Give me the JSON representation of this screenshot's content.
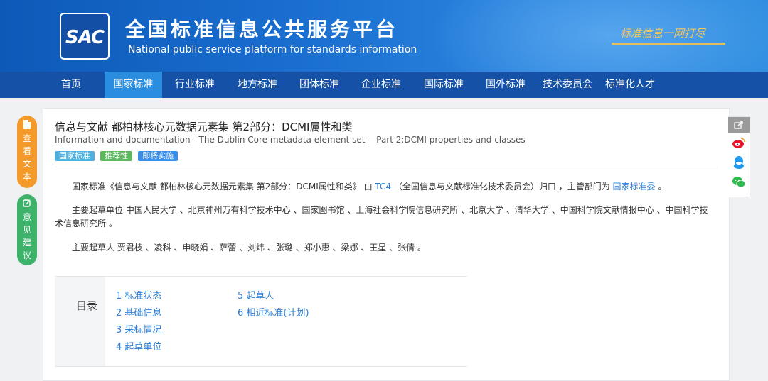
{
  "header": {
    "logo_text": "SAC",
    "title": "全国标准信息公共服务平台",
    "subtitle": "National public service platform  for standards information",
    "slogan": "标准信息一网打尽"
  },
  "nav": {
    "items": [
      {
        "label": "首页"
      },
      {
        "label": "国家标准"
      },
      {
        "label": "行业标准"
      },
      {
        "label": "地方标准"
      },
      {
        "label": "团体标准"
      },
      {
        "label": "企业标准"
      },
      {
        "label": "国际标准"
      },
      {
        "label": "国外标准"
      },
      {
        "label": "技术委员会"
      },
      {
        "label": "标准化人才"
      }
    ],
    "active": "国家标准"
  },
  "side": {
    "view_text": "查看文本",
    "feedback": "意见建议"
  },
  "standard": {
    "title": "信息与文献 都柏林核心元数据元素集 第2部分：DCMI属性和类",
    "title_en": "Information and documentation—The Dublin Core metadata element set —Part 2:DCMI properties and classes",
    "badges": [
      {
        "label": "国家标准",
        "color": "#4fb0e0"
      },
      {
        "label": "推荐性",
        "color": "#5cb85c"
      },
      {
        "label": "即将实施",
        "color": "#3a8ee6"
      }
    ],
    "summary": {
      "prefix": "国家标准《信息与文献 都柏林核心元数据元素集 第2部分：DCMI属性和类》 由",
      "tc": "TC4",
      "middle": "（全国信息与文献标准化技术委员会）归口 ，主管部门为",
      "dept": "国家标准委",
      "suffix": "。"
    },
    "drafting_units": "主要起草单位 中国人民大学 、北京神州万有科学技术中心 、国家图书馆 、上海社会科学院信息研究所 、北京大学 、清华大学 、中国科学院文献情报中心 、中国科学技术信息研究所 。",
    "drafters": "主要起草人 贾君枝 、凌科 、申晓娟 、萨蕾 、刘炜 、张璐 、郑小惠 、梁娜 、王星 、张倩 。"
  },
  "toc": {
    "heading": "目录",
    "left": [
      "1  标准状态",
      "2  基础信息",
      "3  采标情况",
      "4  起草单位"
    ],
    "right": [
      "5  起草人",
      "6  相近标准(计划)"
    ]
  },
  "colors": {
    "nav_bg": "#1552a7",
    "nav_active": "#2a8de0",
    "link": "#2a7fd6",
    "view_btn": "#f39a2b",
    "feedback_btn": "#3db26a"
  }
}
